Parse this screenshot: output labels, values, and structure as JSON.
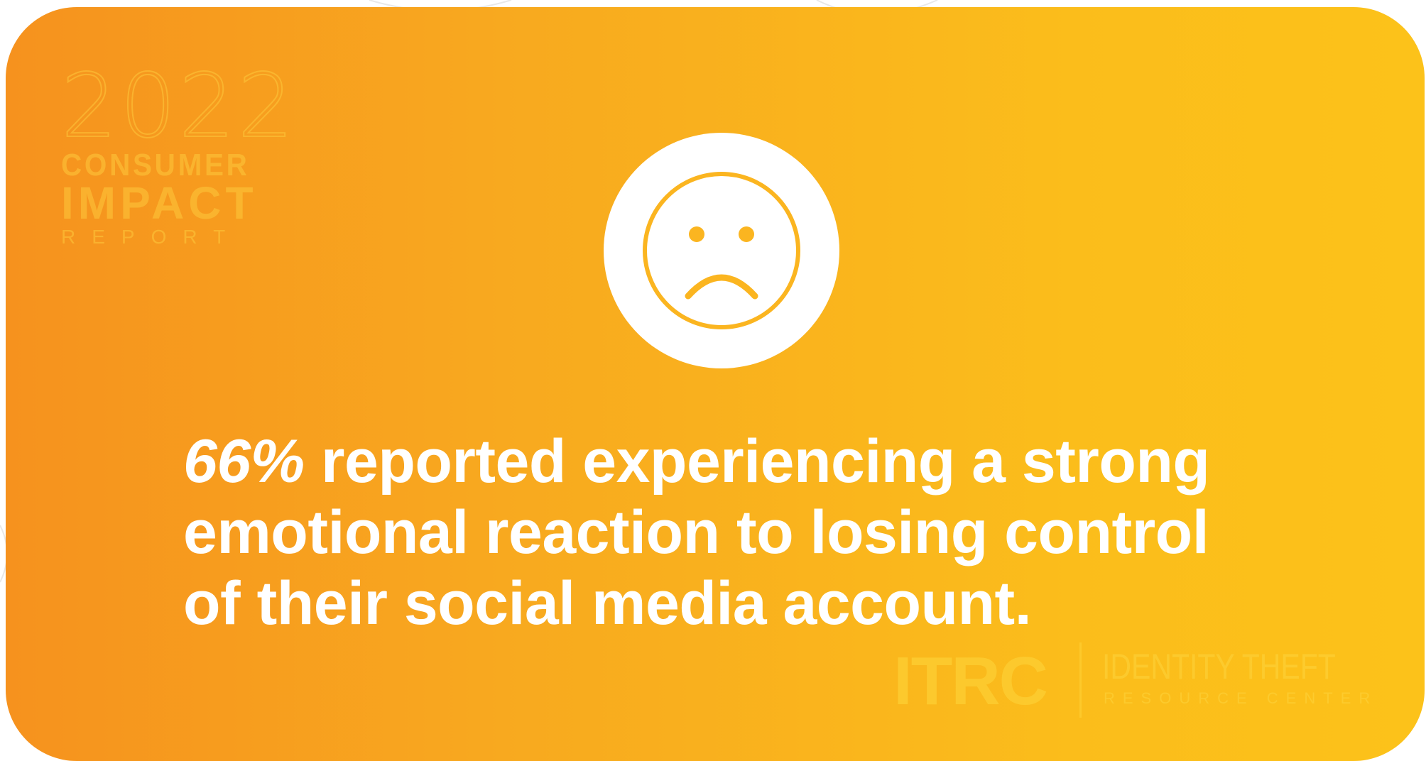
{
  "colors": {
    "gradient_start": "#f6921e",
    "gradient_end": "#fcc21a",
    "text": "#ffffff",
    "watermark": "#fdc832"
  },
  "report_logo": {
    "year": "2022",
    "line1": "CONSUMER",
    "line2": "IMPACT",
    "line3": "REPORT"
  },
  "icon": "sad-face-icon",
  "message": {
    "stat": "66%",
    "text": " reported experiencing a strong emotional reaction to losing control of their social media account."
  },
  "org_logo": {
    "mark": "ITRC",
    "name": "IDENTITY THEFT",
    "sub": "RESOURCE CENTER"
  }
}
